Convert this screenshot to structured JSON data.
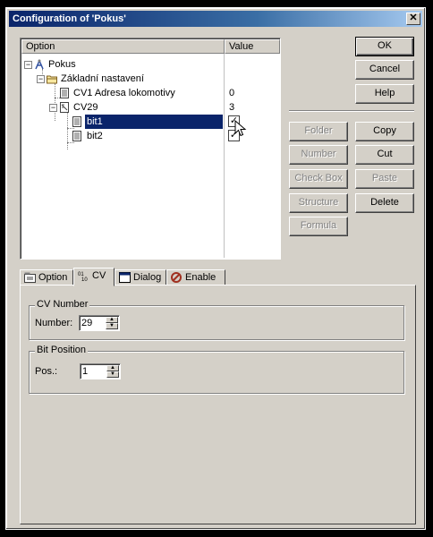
{
  "window": {
    "title": "Configuration of 'Pokus'",
    "close_glyph": "✕"
  },
  "tree": {
    "columns": {
      "option": "Option",
      "value": "Value"
    },
    "nodes": [
      {
        "label": "Pokus",
        "value": "",
        "icon": "device-icon",
        "expander": "−"
      },
      {
        "label": "Základní nastavení",
        "value": "",
        "icon": "folder-icon",
        "expander": "−"
      },
      {
        "label": "CV1 Adresa lokomotivy",
        "value": "0",
        "icon": "number-icon"
      },
      {
        "label": "CV29",
        "value": "3",
        "icon": "bits-icon",
        "expander": "−"
      },
      {
        "label": "bit1",
        "value": "✓",
        "icon": "checkbox-item-icon",
        "selected": true
      },
      {
        "label": "bit2",
        "value": "✓",
        "icon": "checkbox-item-icon"
      }
    ]
  },
  "buttons": {
    "ok": "OK",
    "cancel": "Cancel",
    "help": "Help",
    "folder": "Folder",
    "copy": "Copy",
    "number": "Number",
    "cut": "Cut",
    "checkbox": "Check Box",
    "paste": "Paste",
    "structure": "Structure",
    "delete": "Delete",
    "formula": "Formula"
  },
  "tabs": [
    {
      "label": "Option",
      "icon": "option-icon"
    },
    {
      "label": "CV",
      "icon": "cv-icon",
      "active": true
    },
    {
      "label": "Dialog",
      "icon": "dialog-icon"
    },
    {
      "label": "Enable",
      "icon": "enable-icon"
    }
  ],
  "cv_panel": {
    "cv_group": "CV Number",
    "number_label": "Number:",
    "number_value": "29",
    "bit_group": "Bit Position",
    "pos_label": "Pos.:",
    "pos_value": "1"
  },
  "colors": {
    "selection": "#0a246a",
    "face": "#d4d0c8",
    "title_start": "#0a246a"
  }
}
